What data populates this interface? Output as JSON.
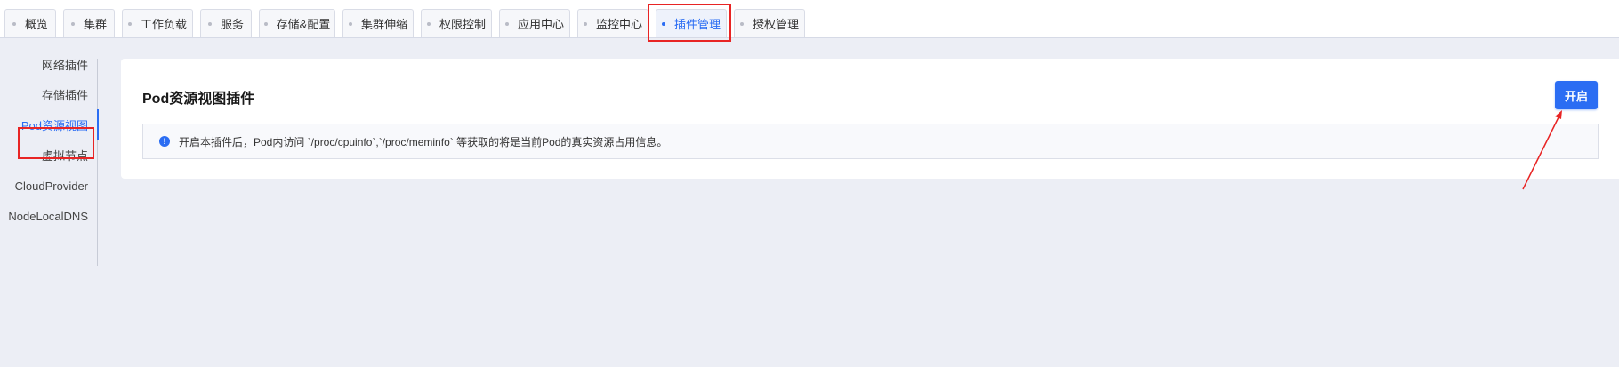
{
  "tabs": [
    {
      "label": "概览"
    },
    {
      "label": "集群"
    },
    {
      "label": "工作负载"
    },
    {
      "label": "服务"
    },
    {
      "label": "存储&配置"
    },
    {
      "label": "集群伸缩"
    },
    {
      "label": "权限控制"
    },
    {
      "label": "应用中心"
    },
    {
      "label": "监控中心"
    },
    {
      "label": "插件管理",
      "active": true
    },
    {
      "label": "授权管理"
    }
  ],
  "sidebar": {
    "items": [
      {
        "label": "网络插件"
      },
      {
        "label": "存储插件"
      },
      {
        "label": "Pod资源视图",
        "active": true
      },
      {
        "label": "虚拟节点"
      },
      {
        "label": "CloudProvider"
      },
      {
        "label": "NodeLocalDNS"
      }
    ]
  },
  "main": {
    "title": "Pod资源视图插件",
    "enable_button": "开启",
    "notice_icon": "!",
    "notice_text": "开启本插件后，Pod内访问 `/proc/cpuinfo`,`/proc/meminfo` 等获取的将是当前Pod的真实资源占用信息。"
  },
  "colors": {
    "accent": "#2b6df3",
    "highlight": "#e82424",
    "background": "#eceef5"
  }
}
